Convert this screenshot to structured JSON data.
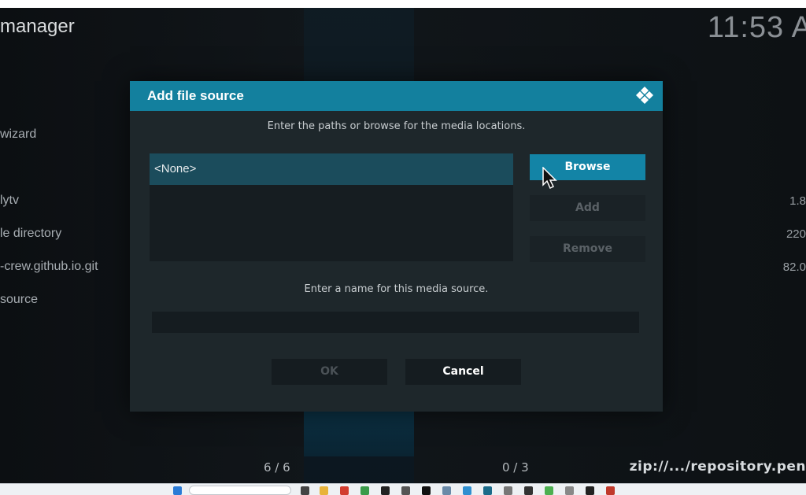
{
  "background": {
    "title": "manager",
    "clock": "11:53 A",
    "list_items": [
      "wizard",
      "lytv",
      "le directory",
      "-crew.github.io.git",
      "source"
    ],
    "list_sizes": [
      "1.8",
      "220",
      "82.0"
    ],
    "pager_left": "6 / 6",
    "pager_right": "0 / 3",
    "zip_path": "zip://.../repository.pen"
  },
  "dialog": {
    "title": "Add file source",
    "paths_hint": "Enter the paths or browse for the media locations.",
    "path_items": [
      "<None>"
    ],
    "browse_label": "Browse",
    "add_label": "Add",
    "remove_label": "Remove",
    "name_hint": "Enter a name for this media source.",
    "name_value": "",
    "ok_label": "OK",
    "cancel_label": "Cancel"
  },
  "colors": {
    "header": "#13809e",
    "accent_button": "#1384a6",
    "selected_row": "#1b4c5c",
    "dialog_bg": "#1e272b"
  },
  "icons": {
    "logo": "kodi-logo-icon",
    "cursor": "mouse-pointer-icon"
  }
}
